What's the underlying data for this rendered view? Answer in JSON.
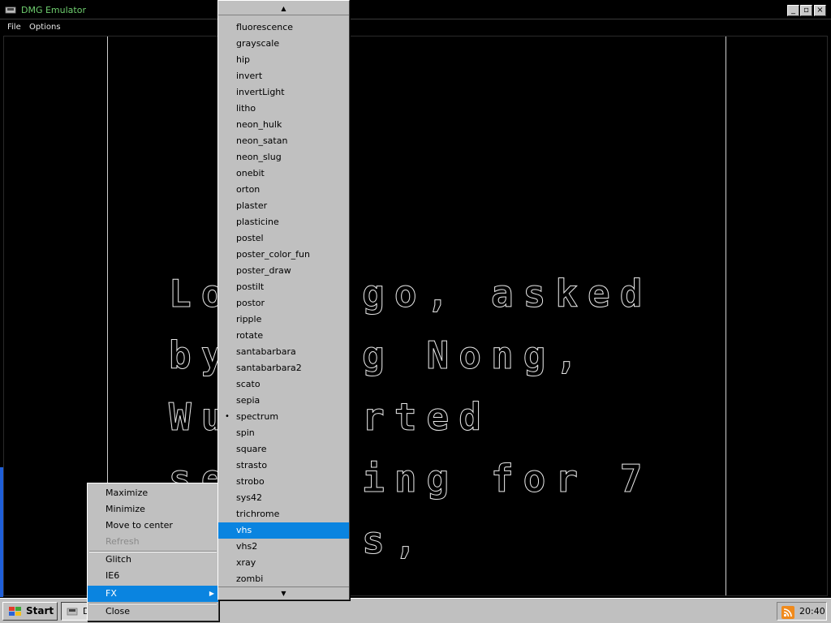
{
  "window": {
    "title": "DMG Emulator",
    "controls": [
      "_",
      "▫",
      "×"
    ]
  },
  "menubar": {
    "items": [
      "File",
      "Options"
    ]
  },
  "screen": {
    "lines": [
      "Long ago, asked",
      "by Bong Nong,",
      "Wu started",
      "searching for 7",
      "  balls,"
    ]
  },
  "context_menu": {
    "items": [
      {
        "label": "Maximize",
        "disabled": false
      },
      {
        "label": "Minimize",
        "disabled": false
      },
      {
        "label": "Move to center",
        "disabled": false
      },
      {
        "label": "Refresh",
        "disabled": true
      },
      {
        "label": "Glitch",
        "disabled": false
      },
      {
        "label": "IE6",
        "disabled": false
      },
      {
        "label": "FX",
        "disabled": false,
        "highlighted": true,
        "has_submenu": true
      },
      {
        "label": "Close",
        "disabled": false
      }
    ]
  },
  "fx_menu": {
    "scroll_up": "▲",
    "scroll_down": "▼",
    "items": [
      "fluorescence",
      "grayscale",
      "hip",
      "invert",
      "invertLight",
      "litho",
      "neon_hulk",
      "neon_satan",
      "neon_slug",
      "onebit",
      "orton",
      "plaster",
      "plasticine",
      "postel",
      "poster_color_fun",
      "poster_draw",
      "postilt",
      "postor",
      "ripple",
      "rotate",
      "santabarbara",
      "santabarbara2",
      "scato",
      "sepia",
      "spectrum",
      "spin",
      "square",
      "strasto",
      "strobo",
      "sys42",
      "trichrome",
      "vhs",
      "vhs2",
      "xray",
      "zombi"
    ],
    "checked": "spectrum",
    "highlighted": "vhs"
  },
  "taskbar": {
    "start_label": "Start",
    "task_label": "D",
    "clock": "20:40"
  },
  "icons": {
    "app": "emulator-icon",
    "start": "windows-logo-icon",
    "tray": "rss-feed-icon"
  },
  "colors": {
    "title_text": "#6fcf6f",
    "highlight": "#0a84e0",
    "menu_bg": "#c0c0c0",
    "accent_bar": "#1f5fd8"
  }
}
